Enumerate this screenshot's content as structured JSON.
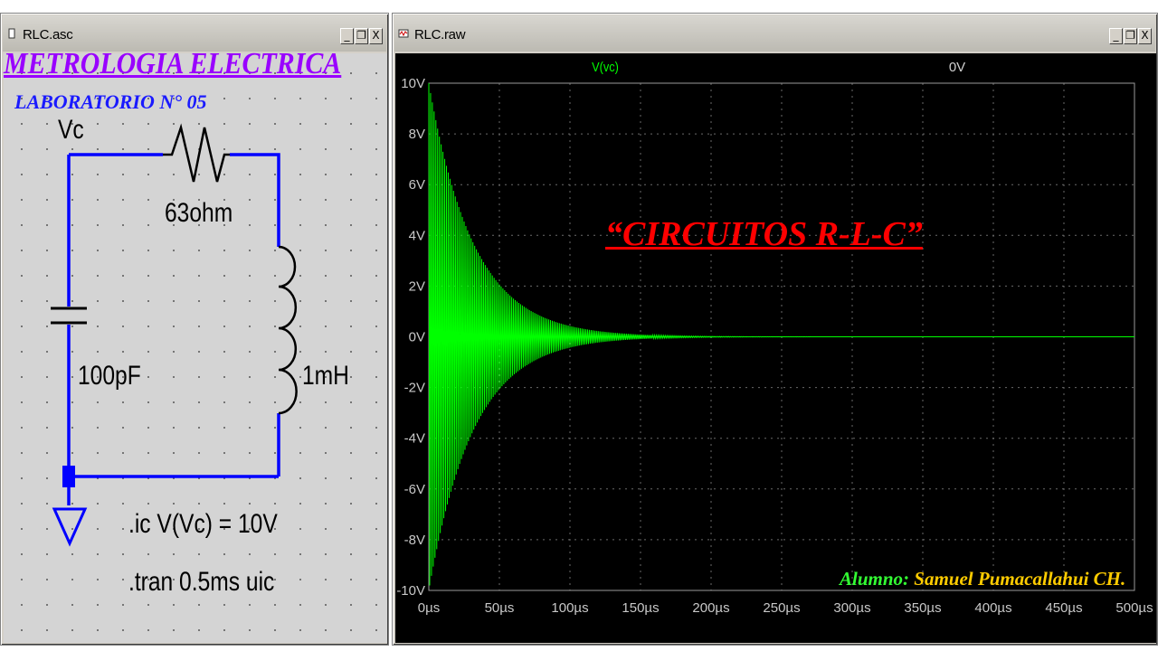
{
  "schematic_window": {
    "title": "RLC.asc",
    "controls": {
      "minimize": "_",
      "restore": "❐",
      "close": "X"
    },
    "overlay": {
      "course": "METROLOGIA ELECTRICA",
      "lab": "LABORATORIO N° 05"
    },
    "labels": {
      "node": "Vc",
      "resistor": "63ohm",
      "capacitor": "100pF",
      "inductor": "1mH",
      "ic_directive": ".ic V(Vc) = 10V",
      "tran_directive": ".tran 0.5ms uic"
    },
    "wire_color": "#0000ff"
  },
  "waveform_window": {
    "title": "RLC.raw",
    "controls": {
      "minimize": "_",
      "restore": "❐",
      "close": "X"
    },
    "trace_label": "V(vc)",
    "cursor_readout": "0V",
    "overlay_title": "“CIRCUITOS R-L-C”",
    "student_label": "Alumno:",
    "student_name": "Samuel Pumacallahui CH.",
    "colors": {
      "trace": "#00ff00",
      "grid": "#6a6a6a",
      "background": "#000000",
      "title": "#ff0000",
      "name": "#ffcc00"
    }
  },
  "chart_data": {
    "type": "line",
    "title": "",
    "xlabel": "",
    "ylabel": "",
    "series": [
      {
        "name": "V(vc)",
        "description_of_shape": "damped oscillation, envelope 10V·exp(-t/31.7µs)",
        "amplitude_V": 10,
        "decay_time_constant_us": 31.7,
        "approx_settle_us": 150
      }
    ],
    "xlim": [
      0,
      500
    ],
    "ylim": [
      -10,
      10
    ],
    "x_ticks": [
      "0µs",
      "50µs",
      "100µs",
      "150µs",
      "200µs",
      "250µs",
      "300µs",
      "350µs",
      "400µs",
      "450µs",
      "500µs"
    ],
    "y_ticks": [
      "10V",
      "8V",
      "6V",
      "4V",
      "2V",
      "0V",
      "-2V",
      "-4V",
      "-6V",
      "-8V",
      "-10V"
    ],
    "grid": true
  }
}
